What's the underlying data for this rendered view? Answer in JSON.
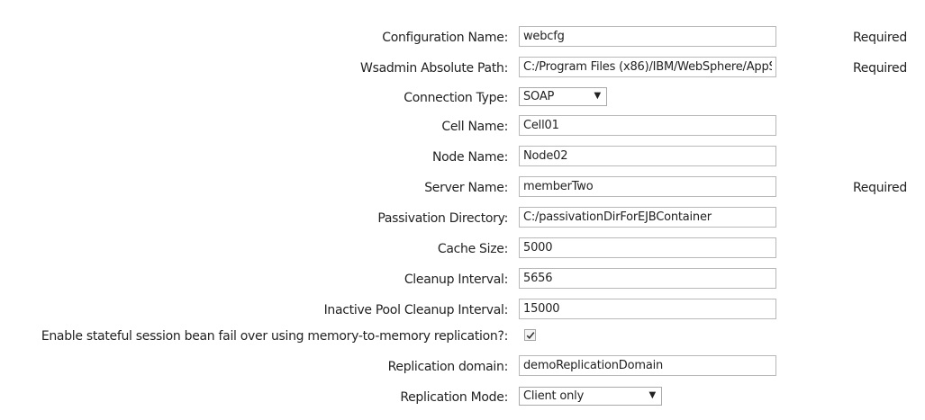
{
  "form": {
    "required_text": "Required",
    "fields": {
      "configuration_name": {
        "label": "Configuration Name:",
        "value": "webcfg"
      },
      "wsadmin_path": {
        "label": "Wsadmin Absolute Path:",
        "value": "C:/Program Files (x86)/IBM/WebSphere/AppS"
      },
      "connection_type": {
        "label": "Connection Type:",
        "value": "SOAP"
      },
      "cell_name": {
        "label": "Cell Name:",
        "value": "Cell01"
      },
      "node_name": {
        "label": "Node Name:",
        "value": "Node02"
      },
      "server_name": {
        "label": "Server Name:",
        "value": "memberTwo"
      },
      "passivation_directory": {
        "label": "Passivation Directory:",
        "value": "C:/passivationDirForEJBContainer"
      },
      "cache_size": {
        "label": "Cache Size:",
        "value": "5000"
      },
      "cleanup_interval": {
        "label": "Cleanup Interval:",
        "value": "5656"
      },
      "inactive_pool_cleanup_interval": {
        "label": "Inactive Pool Cleanup Interval:",
        "value": "15000"
      },
      "enable_failover": {
        "label": "Enable stateful session bean fail over using memory-to-memory replication?:",
        "checked": true
      },
      "replication_domain": {
        "label": "Replication domain:",
        "value": "demoReplicationDomain"
      },
      "replication_mode": {
        "label": "Replication Mode:",
        "value": "Client only"
      }
    }
  }
}
